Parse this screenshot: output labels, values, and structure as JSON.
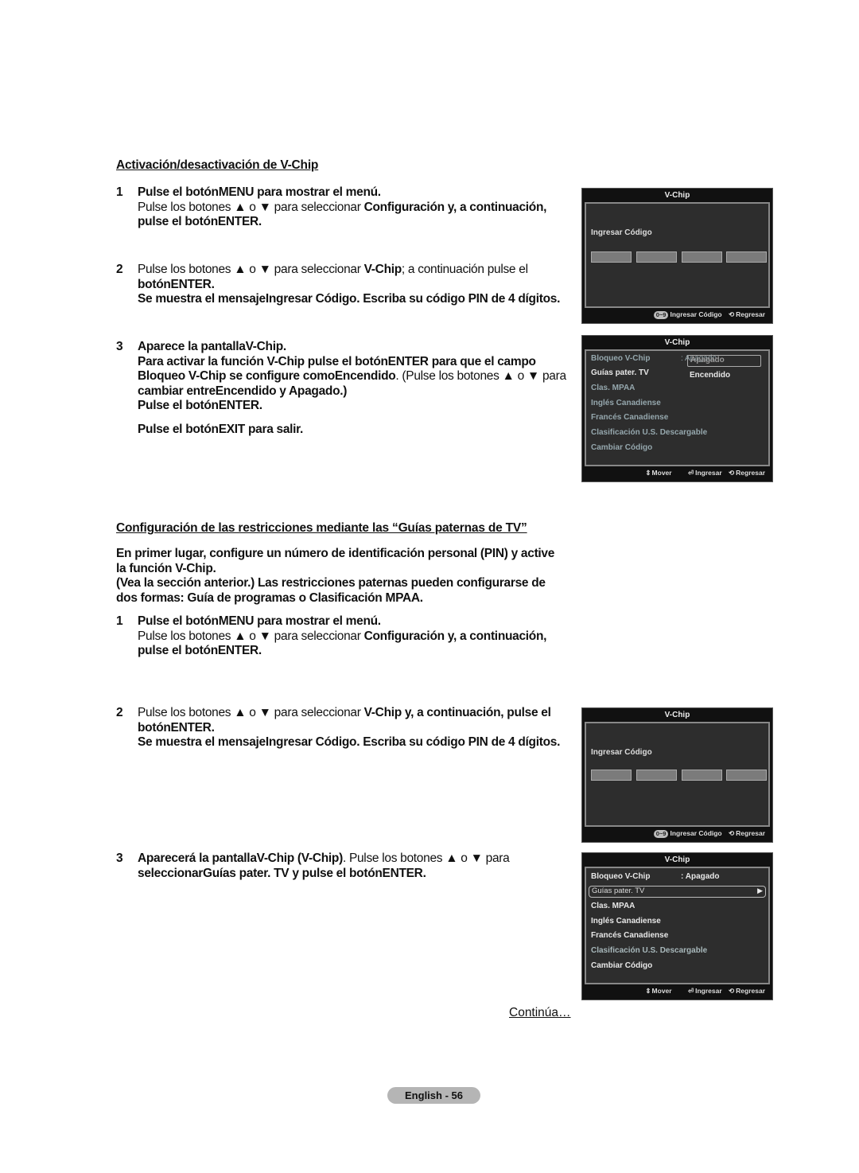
{
  "section1": {
    "heading": "Activación/desactivación de V-Chip",
    "steps": [
      {
        "num": "1",
        "lines": [
          {
            "bold": "Pulse el botónMENU para mostrar el menú."
          },
          {
            "normal": "Pulse los botones ▲ o ▼ para seleccionar ",
            "bold": "Configuración y, a continuación,"
          },
          {
            "bold": "pulse el botónENTER."
          }
        ]
      },
      {
        "num": "2",
        "lines": [
          {
            "normal": "Pulse los botones ▲ o ▼ para seleccionar ",
            "bold": "V-Chip",
            "normal2": "; a continuación pulse el"
          },
          {
            "bold": "botónENTER."
          },
          {
            "bold": "Se muestra el mensajeIngresar Código. Escriba su código PIN de 4 dígitos."
          }
        ]
      },
      {
        "num": "3",
        "lines": [
          {
            "bold": "Aparece la pantallaV-Chip."
          },
          {
            "bold": "Para activar la función V-Chip pulse el botónENTER para que el campo"
          },
          {
            "bold": "Bloqueo V-Chip se configure comoEncendido",
            "normal": ". (Pulse los botones ▲ o ▼ para"
          },
          {
            "bold": "cambiar entreEncendido y Apagado.)"
          },
          {
            "bold": "Pulse el botónENTER."
          },
          {
            "bold": "Pulse el botónEXIT para salir."
          }
        ]
      }
    ]
  },
  "section2": {
    "heading": "Configuración de las restricciones mediante las “Guías paternas de TV”",
    "intro": [
      "En primer lugar, configure un número de identificación personal (PIN) y active",
      "la función V-Chip.",
      "(Vea la sección anterior.) Las restricciones paternas pueden configurarse de",
      "dos formas: Guía de programas o Clasificación MPAA."
    ],
    "steps": [
      {
        "num": "1",
        "lines": [
          {
            "bold": "Pulse el botónMENU para mostrar el menú."
          },
          {
            "normal": "Pulse los botones ▲ o ▼ para seleccionar ",
            "bold": "Configuración y, a continuación,"
          },
          {
            "bold": "pulse el botónENTER."
          }
        ]
      },
      {
        "num": "2",
        "lines": [
          {
            "normal": "Pulse los botones ▲ o ▼ para seleccionar ",
            "bold": "V-Chip y, a continuación, pulse el"
          },
          {
            "bold": "botónENTER."
          },
          {
            "bold": "Se muestra el mensajeIngresar Código. Escriba su código PIN de 4 dígitos."
          }
        ]
      },
      {
        "num": "3",
        "lines": [
          {
            "bold": "Aparecerá la pantallaV-Chip (V-Chip)",
            "normal": ". Pulse los botones ▲ o ▼ para"
          },
          {
            "bold": "seleccionarGuías pater. TV y pulse el botónENTER."
          }
        ]
      }
    ]
  },
  "osd_pin": {
    "title": "V-Chip",
    "label": "Ingresar Código",
    "footer": {
      "keycap": "0~9",
      "enter_code": "Ingresar Código",
      "return_icon": "return-icon",
      "return": "Regresar"
    }
  },
  "osd_menu_1": {
    "title": "V-Chip",
    "items": [
      "Bloqueo V-Chip",
      "Guías pater. TV",
      "Clas. MPAA",
      "Inglés Canadiense",
      "Francés Canadiense",
      "Clasificación U.S. Descargable",
      "Cambiar Código"
    ],
    "lock_value": ": Apagado",
    "dropdown_options": [
      "Apagado",
      "Encendido"
    ],
    "footer": {
      "move_icon": "up-down-icon",
      "move": "Mover",
      "enter_icon": "enter-icon",
      "enter": "Ingresar",
      "return_icon": "return-icon",
      "return": "Regresar"
    }
  },
  "osd_menu_2": {
    "title": "V-Chip",
    "items": [
      "Bloqueo V-Chip",
      "Guías pater. TV",
      "Clas. MPAA",
      "Inglés Canadiense",
      "Francés Canadiense",
      "Clasificación U.S. Descargable",
      "Cambiar Código"
    ],
    "lock_value": ": Apagado",
    "selected_arrow": "▶",
    "footer": {
      "move_icon": "up-down-icon",
      "move": "Mover",
      "enter_icon": "enter-icon",
      "enter": "Ingresar",
      "return_icon": "return-icon",
      "return": "Regresar"
    }
  },
  "continua": "Continúa…",
  "page_label": "English - 56"
}
